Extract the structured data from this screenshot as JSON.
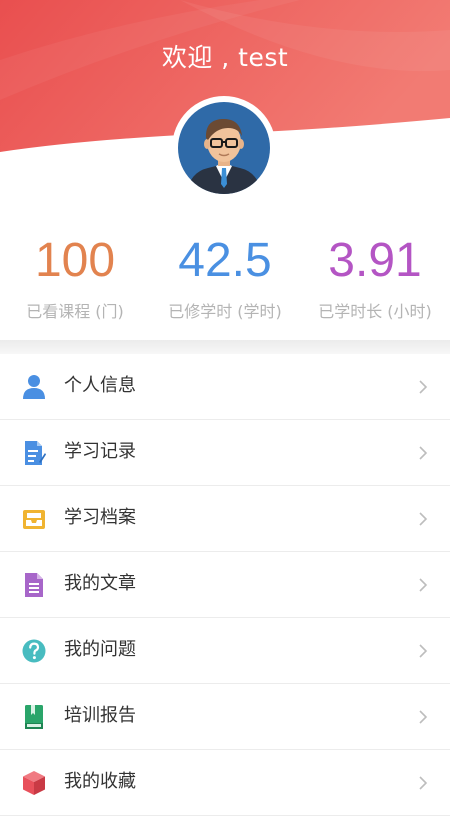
{
  "header": {
    "welcome": "欢迎 , test",
    "gradient_from": "#e94f4f",
    "gradient_to": "#f27b73"
  },
  "avatar": {
    "icon": "user-avatar-icon"
  },
  "stats": [
    {
      "value": "100",
      "label": "已看课程 (门)",
      "color": "#e2834f"
    },
    {
      "value": "42.5",
      "label": "已修学时 (学时)",
      "color": "#4a90e2"
    },
    {
      "value": "3.91",
      "label": "已学时长 (小时)",
      "color": "#b455c4"
    }
  ],
  "menu": [
    {
      "label": "个人信息",
      "icon": "person-icon",
      "color": "#4a8fe2"
    },
    {
      "label": "学习记录",
      "icon": "study-record-icon",
      "color": "#4a8fe2"
    },
    {
      "label": "学习档案",
      "icon": "archive-tray-icon",
      "color": "#f0b431"
    },
    {
      "label": "我的文章",
      "icon": "document-icon",
      "color": "#a766c9"
    },
    {
      "label": "我的问题",
      "icon": "question-icon",
      "color": "#48bcc0"
    },
    {
      "label": "培训报告",
      "icon": "report-book-icon",
      "color": "#2aa56a"
    },
    {
      "label": "我的收藏",
      "icon": "favorite-box-icon",
      "color": "#e8505b"
    }
  ]
}
